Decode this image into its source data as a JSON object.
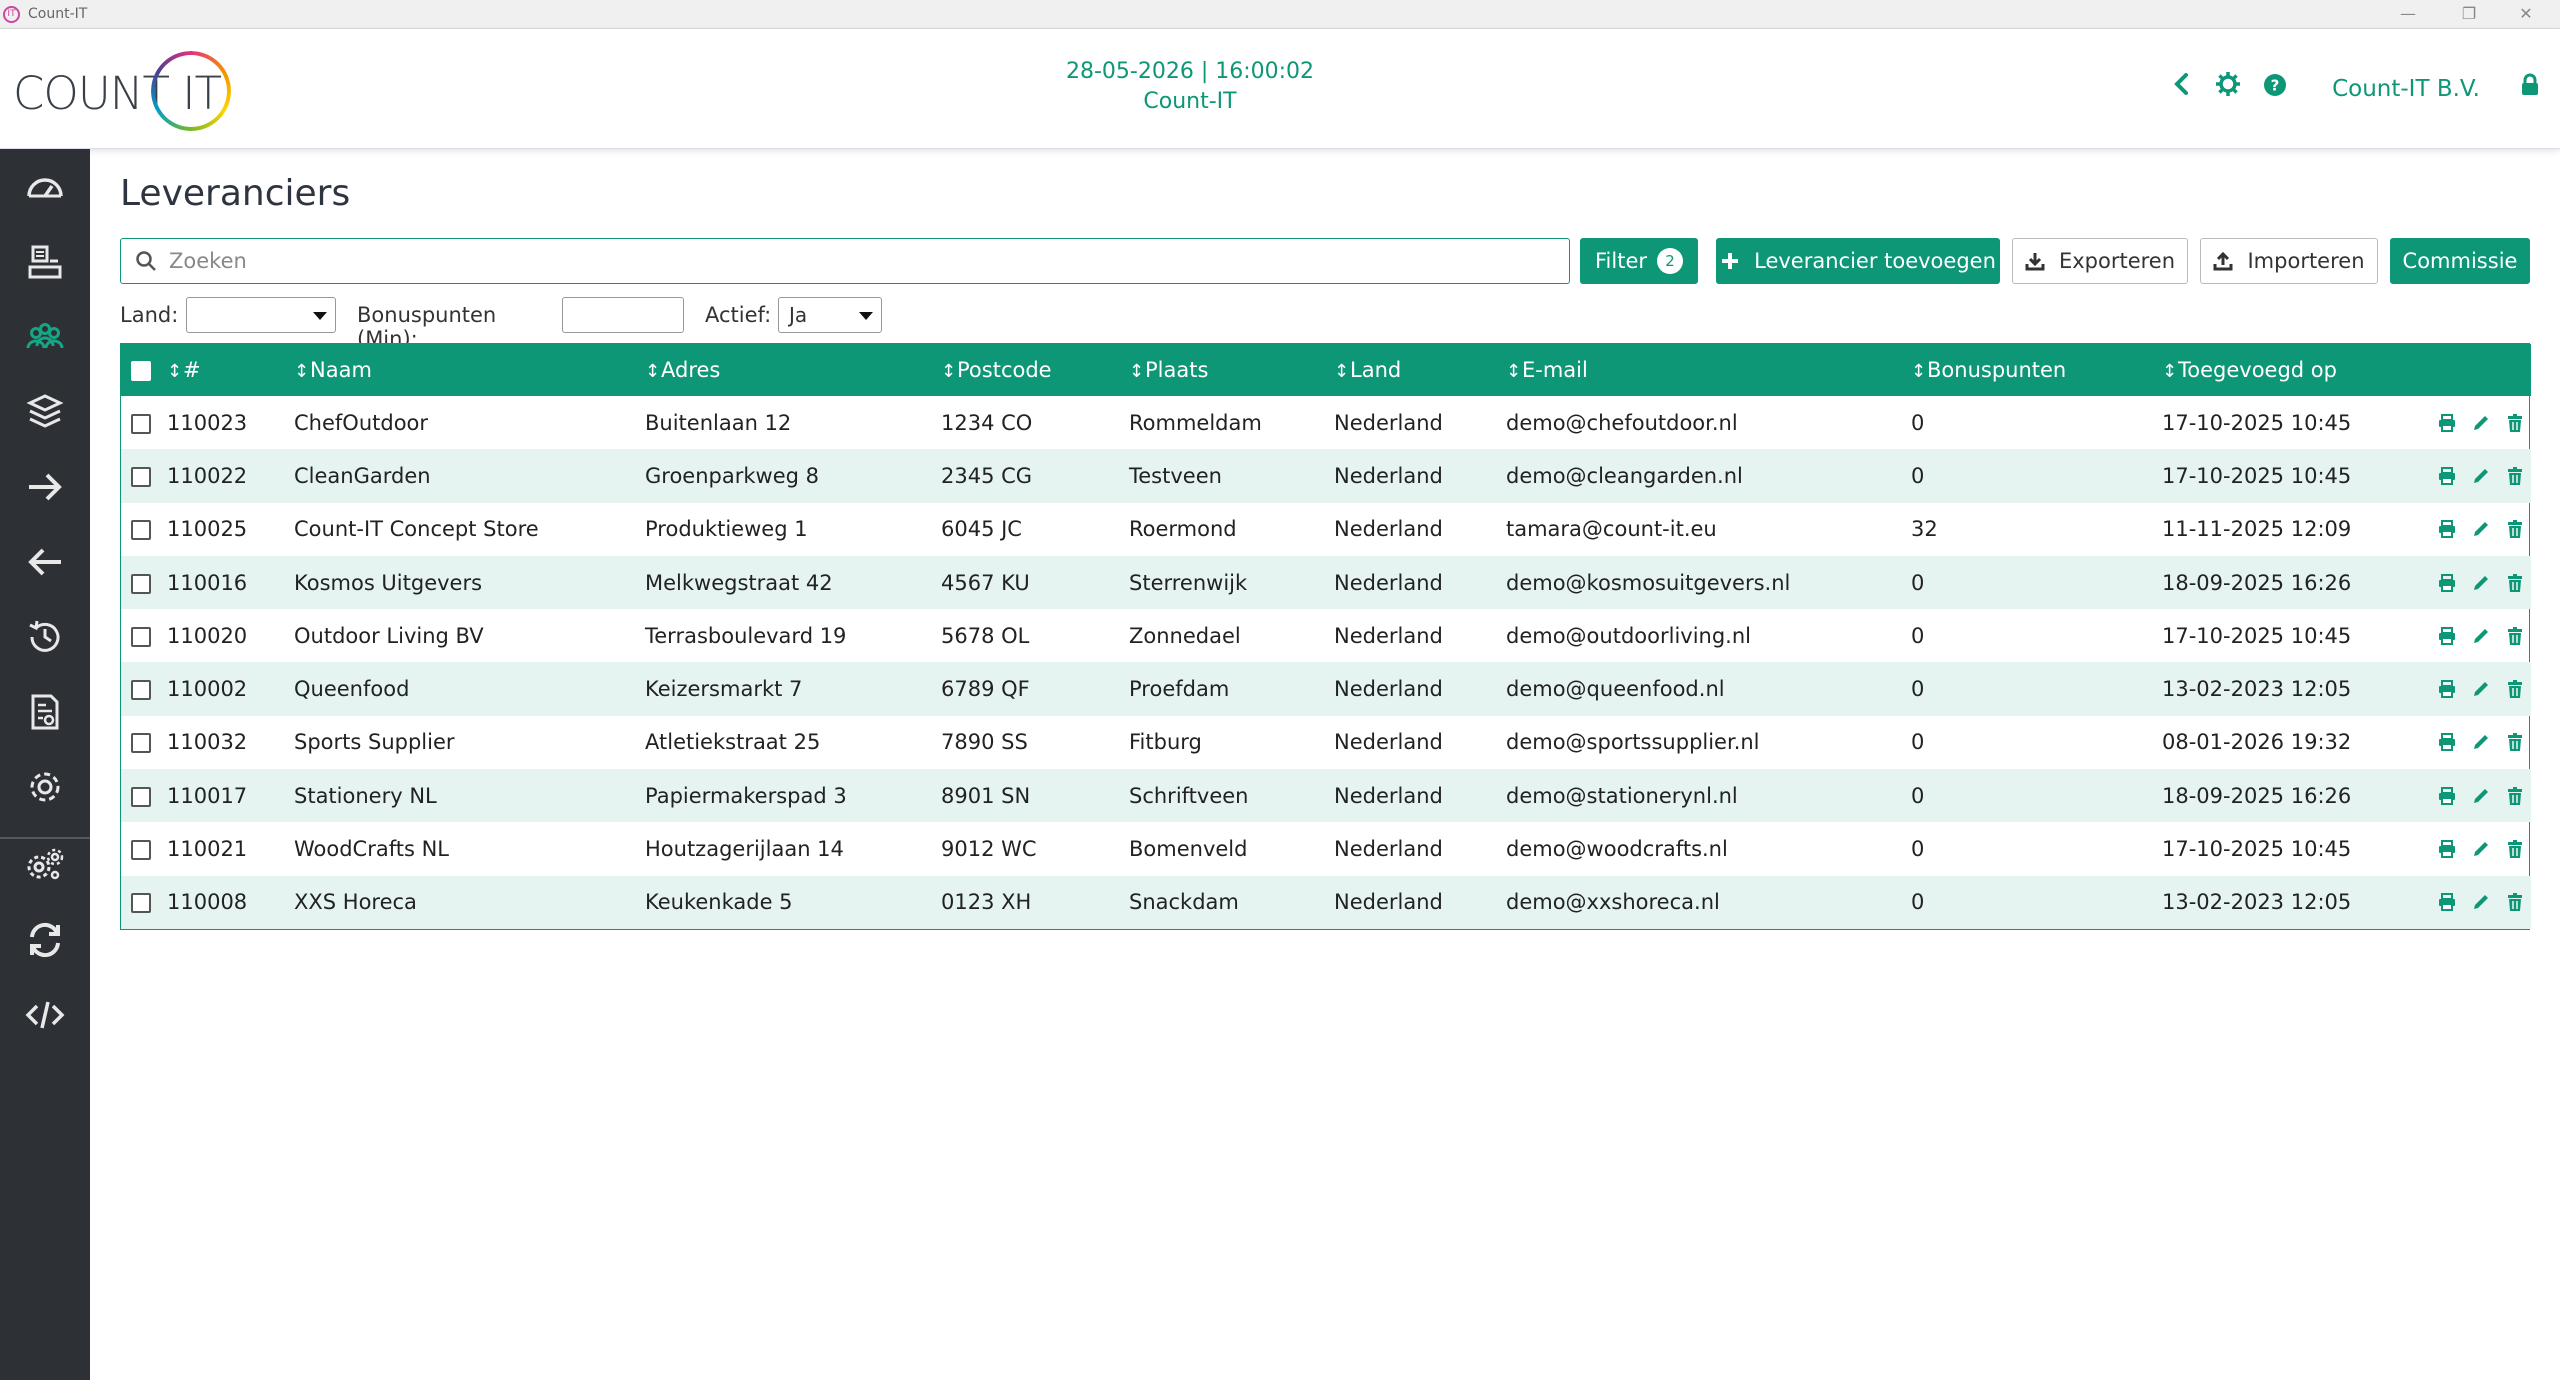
{
  "window": {
    "title": "Count-IT",
    "icon_text": "IT",
    "min": "—",
    "restore": "❐",
    "close": "✕"
  },
  "header": {
    "logo_text": "COUNT IT",
    "datetime": "28-05-2026 | 16:00:02",
    "subtitle": "Count-IT",
    "company": "Count-IT B.V."
  },
  "page": {
    "title": "Leveranciers"
  },
  "toolbar": {
    "search_placeholder": "Zoeken",
    "filter_label": "Filter",
    "filter_count": "2",
    "add_label": "Leverancier toevoegen",
    "export_label": "Exporteren",
    "import_label": "Importeren",
    "commission_label": "Commissie"
  },
  "filters": {
    "land_label": "Land:",
    "land_value": "",
    "bonus_label": "Bonuspunten (Min):",
    "bonus_value": "",
    "active_label": "Actief:",
    "active_value": "Ja"
  },
  "table": {
    "columns": [
      "#",
      "Naam",
      "Adres",
      "Postcode",
      "Plaats",
      "Land",
      "E-mail",
      "Bonuspunten",
      "Toegevoegd op"
    ],
    "rows": [
      [
        "110023",
        "ChefOutdoor",
        "Buitenlaan 12",
        "1234 CO",
        "Rommeldam",
        "Nederland",
        "demo@chefoutdoor.nl",
        "0",
        "17-10-2025 10:45"
      ],
      [
        "110022",
        "CleanGarden",
        "Groenparkweg 8",
        "2345 CG",
        "Testveen",
        "Nederland",
        "demo@cleangarden.nl",
        "0",
        "17-10-2025 10:45"
      ],
      [
        "110025",
        "Count-IT Concept Store",
        "Produktieweg 1",
        "6045 JC",
        "Roermond",
        "Nederland",
        "tamara@count-it.eu",
        "32",
        "11-11-2025 12:09"
      ],
      [
        "110016",
        "Kosmos Uitgevers",
        "Melkwegstraat 42",
        "4567 KU",
        "Sterrenwijk",
        "Nederland",
        "demo@kosmosuitgevers.nl",
        "0",
        "18-09-2025 16:26"
      ],
      [
        "110020",
        "Outdoor Living BV",
        "Terrasboulevard 19",
        "5678 OL",
        "Zonnedael",
        "Nederland",
        "demo@outdoorliving.nl",
        "0",
        "17-10-2025 10:45"
      ],
      [
        "110002",
        "Queenfood",
        "Keizersmarkt 7",
        "6789 QF",
        "Proefdam",
        "Nederland",
        "demo@queenfood.nl",
        "0",
        "13-02-2023 12:05"
      ],
      [
        "110032",
        "Sports Supplier",
        "Atletiekstraat 25",
        "7890 SS",
        "Fitburg",
        "Nederland",
        "demo@sportssupplier.nl",
        "0",
        "08-01-2026 19:32"
      ],
      [
        "110017",
        "Stationery NL",
        "Papiermakerspad 3",
        "8901 SN",
        "Schriftveen",
        "Nederland",
        "demo@stationerynl.nl",
        "0",
        "18-09-2025 16:26"
      ],
      [
        "110021",
        "WoodCrafts NL",
        "Houtzagerijlaan 14",
        "9012 WC",
        "Bomenveld",
        "Nederland",
        "demo@woodcrafts.nl",
        "0",
        "17-10-2025 10:45"
      ],
      [
        "110008",
        "XXS Horeca",
        "Keukenkade 5",
        "0123 XH",
        "Snackdam",
        "Nederland",
        "demo@xxshoreca.nl",
        "0",
        "13-02-2023 12:05"
      ]
    ]
  },
  "colors": {
    "accent": "#0e9777",
    "sidebar": "#2d3035",
    "row_alt": "#e6f4f1"
  },
  "sidebar_icons": [
    "dashboard-icon",
    "cash-register-icon",
    "suppliers-icon",
    "products-icon",
    "arrow-right-icon",
    "arrow-left-icon",
    "history-icon",
    "report-icon",
    "settings-icon",
    "advanced-settings-icon",
    "sync-icon",
    "code-icon"
  ]
}
